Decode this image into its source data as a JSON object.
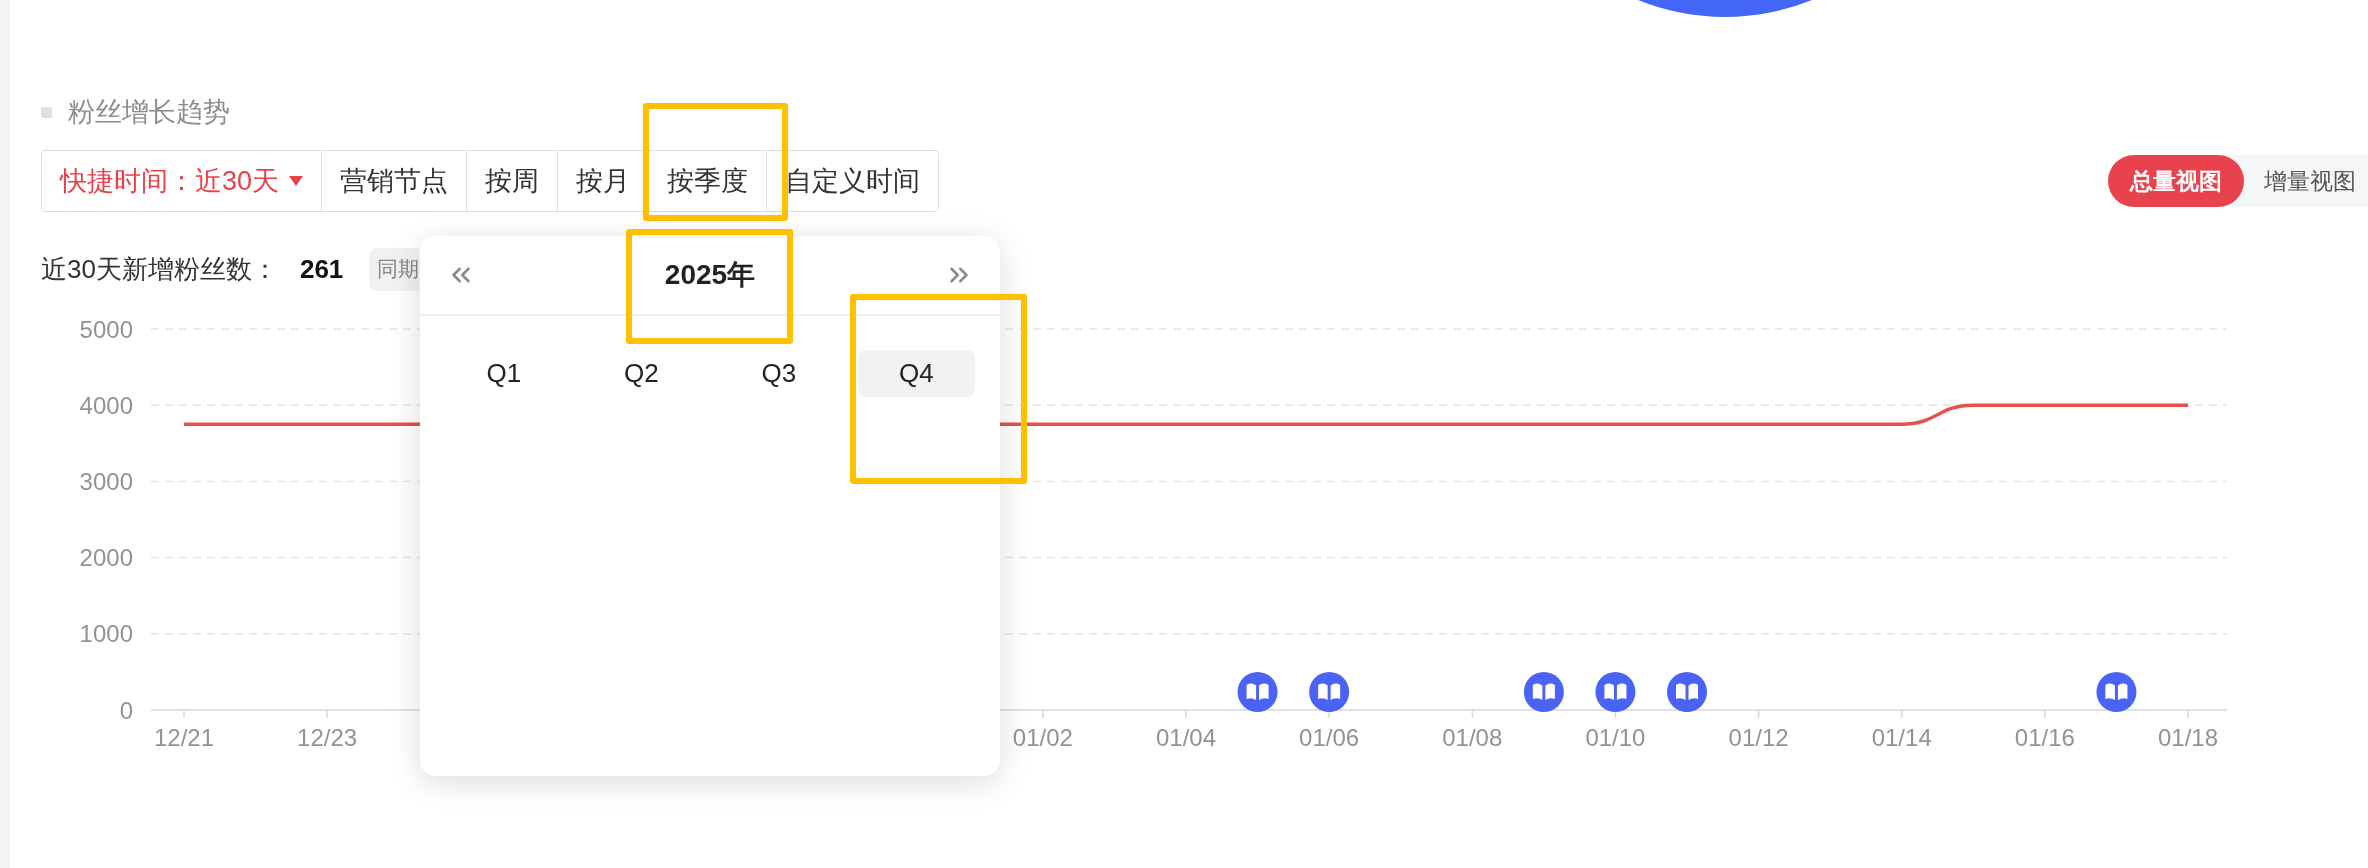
{
  "section": {
    "title": "粉丝增长趋势"
  },
  "toolbar": {
    "tabs": [
      {
        "kind": "dropdown",
        "label": "快捷时间：近30天",
        "selected": true,
        "highlighted": false
      },
      {
        "kind": "button",
        "label": "营销节点",
        "selected": false,
        "highlighted": false
      },
      {
        "kind": "button",
        "label": "按周",
        "selected": false,
        "highlighted": false
      },
      {
        "kind": "button",
        "label": "按月",
        "selected": false,
        "highlighted": false
      },
      {
        "kind": "button",
        "label": "按季度",
        "selected": false,
        "highlighted": true
      },
      {
        "kind": "button",
        "label": "自定义时间",
        "selected": false,
        "highlighted": false
      }
    ]
  },
  "view_toggle": [
    {
      "label": "总量视图",
      "selected": true
    },
    {
      "label": "增量视图",
      "selected": false
    }
  ],
  "summary": {
    "label": "近30天新增粉丝数：",
    "value": "261",
    "badge": "同期"
  },
  "chart": {
    "chart_data": {
      "type": "line",
      "categories": [
        "12/21",
        null,
        "12/23",
        null,
        null,
        null,
        null,
        null,
        null,
        null,
        null,
        null,
        "01/02",
        null,
        "01/04",
        null,
        "01/06",
        null,
        "01/08",
        null,
        "01/10",
        null,
        "01/12",
        null,
        "01/14",
        null,
        "01/16",
        null,
        "01/18"
      ],
      "values": [
        3750,
        3750,
        3750,
        3750,
        null,
        null,
        null,
        null,
        null,
        null,
        null,
        null,
        3750,
        3750,
        3750,
        3750,
        3750,
        3750,
        3750,
        3750,
        3750,
        3750,
        3750,
        3750,
        3750,
        4000,
        4000,
        4000,
        4000
      ],
      "ylim": [
        0,
        5000
      ],
      "yticks": [
        0,
        1000,
        2000,
        3000,
        4000,
        5000
      ],
      "grid": true
    }
  },
  "quarter_picker": {
    "year": {
      "label": "2025年",
      "highlighted": true
    },
    "quarters": [
      {
        "label": "Q1",
        "selected": false,
        "highlighted": false
      },
      {
        "label": "Q2",
        "selected": false,
        "highlighted": false
      },
      {
        "label": "Q3",
        "selected": false,
        "highlighted": false
      },
      {
        "label": "Q4",
        "selected": true,
        "highlighted": true
      }
    ]
  }
}
